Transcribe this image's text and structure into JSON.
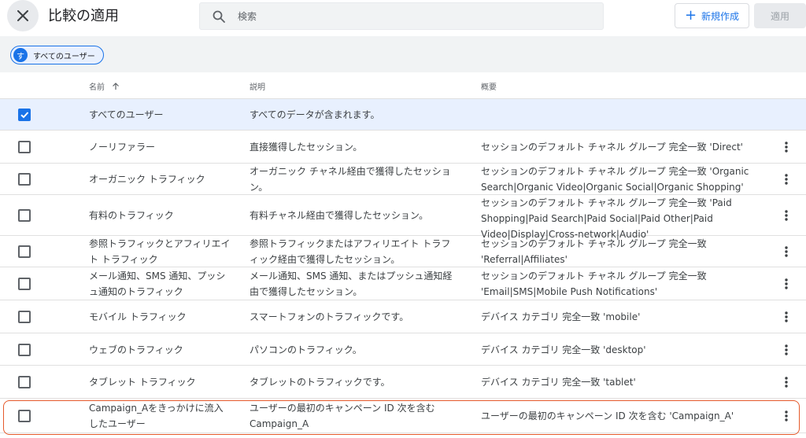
{
  "header": {
    "title": "比較の適用",
    "search_placeholder": "検索",
    "new_button": "新規作成",
    "apply_button": "適用"
  },
  "chip": {
    "avatar": "す",
    "label": "すべてのユーザー"
  },
  "table": {
    "columns": {
      "name": "名前",
      "description": "説明",
      "summary": "概要"
    },
    "rows": [
      {
        "name": "すべてのユーザー",
        "description": "すべてのデータが含まれます。",
        "summary": "",
        "checked": true
      },
      {
        "name": "ノーリファラー",
        "description": "直接獲得したセッション。",
        "summary": "セッションのデフォルト チャネル グループ 完全一致 'Direct'",
        "checked": false
      },
      {
        "name": "オーガニック トラフィック",
        "description": "オーガニック チャネル経由で獲得したセッション。",
        "summary": "セッションのデフォルト チャネル グループ 完全一致 'Organic Search|Organic Video|Organic Social|Organic Shopping'",
        "checked": false
      },
      {
        "name": "有料のトラフィック",
        "description": "有料チャネル経由で獲得したセッション。",
        "summary": "セッションのデフォルト チャネル グループ 完全一致 'Paid Shopping|Paid Search|Paid Social|Paid Other|Paid Video|Display|Cross-network|Audio'",
        "checked": false
      },
      {
        "name": "参照トラフィックとアフィリエイト トラフィック",
        "description": "参照トラフィックまたはアフィリエイト トラフィック経由で獲得したセッション。",
        "summary": "セッションのデフォルト チャネル グループ 完全一致 'Referral|Affiliates'",
        "checked": false
      },
      {
        "name": "メール通知、SMS 通知、プッシュ通知のトラフィック",
        "description": "メール通知、SMS 通知、またはプッシュ通知経由で獲得したセッション。",
        "summary": "セッションのデフォルト チャネル グループ 完全一致 'Email|SMS|Mobile Push Notifications'",
        "checked": false
      },
      {
        "name": "モバイル トラフィック",
        "description": "スマートフォンのトラフィックです。",
        "summary": "デバイス カテゴリ 完全一致 'mobile'",
        "checked": false
      },
      {
        "name": "ウェブのトラフィック",
        "description": "パソコンのトラフィック。",
        "summary": "デバイス カテゴリ 完全一致 'desktop'",
        "checked": false
      },
      {
        "name": "タブレット トラフィック",
        "description": "タブレットのトラフィックです。",
        "summary": "デバイス カテゴリ 完全一致 'tablet'",
        "checked": false
      },
      {
        "name": "Campaign_Aをきっかけに流入したユーザー",
        "description": "ユーザーの最初のキャンペーン ID 次を含む Campaign_A",
        "summary": "ユーザーの最初のキャンペーン ID 次を含む 'Campaign_A'",
        "checked": false
      }
    ]
  },
  "colors": {
    "accent": "#1a73e8",
    "highlight": "#e55a2b",
    "selected_row": "#e8f0fe"
  }
}
